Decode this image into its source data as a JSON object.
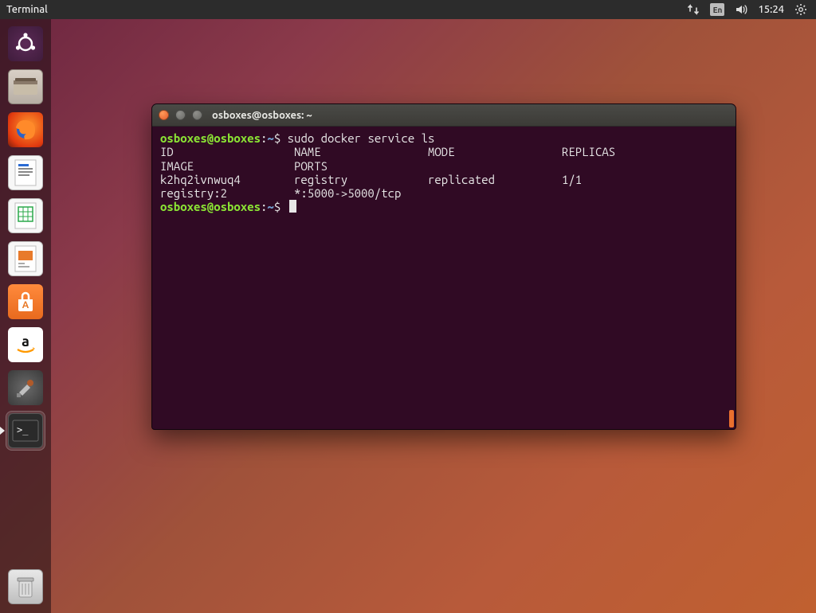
{
  "topbar": {
    "app_title": "Terminal",
    "indicator_lang": "En",
    "time": "15:24"
  },
  "launcher": {
    "items": [
      {
        "name": "dash",
        "label": "Search your computer"
      },
      {
        "name": "files",
        "label": "Files"
      },
      {
        "name": "firefox",
        "label": "Firefox Web Browser"
      },
      {
        "name": "writer",
        "label": "LibreOffice Writer"
      },
      {
        "name": "calc",
        "label": "LibreOffice Calc"
      },
      {
        "name": "impress",
        "label": "LibreOffice Impress"
      },
      {
        "name": "software",
        "label": "Ubuntu Software"
      },
      {
        "name": "amazon",
        "label": "Amazon"
      },
      {
        "name": "settings",
        "label": "System Settings"
      },
      {
        "name": "terminal",
        "label": "Terminal",
        "active": true
      },
      {
        "name": "trash",
        "label": "Trash"
      }
    ]
  },
  "terminal": {
    "title": "osboxes@osboxes: ~",
    "prompt_userhost": "osboxes@osboxes",
    "prompt_sep": ":",
    "prompt_path": "~",
    "prompt_sigil": "$",
    "command": "sudo docker service ls",
    "header_line": "ID                  NAME                MODE                REPLICAS            IMAGE               PORTS",
    "row_line": "k2hq2ivnwuq4        registry            replicated          1/1                 registry:2          *:5000->5000/tcp",
    "service": {
      "id": "k2hq2ivnwuq4",
      "name": "registry",
      "mode": "replicated",
      "replicas": "1/1",
      "image": "registry:2",
      "ports": "*:5000->5000/tcp"
    }
  }
}
